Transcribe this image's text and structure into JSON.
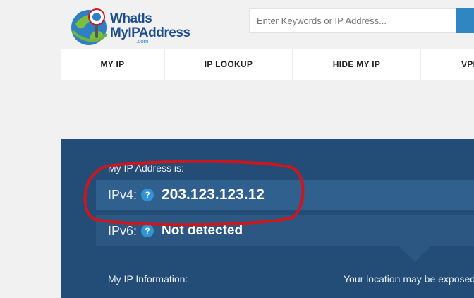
{
  "logo": {
    "line1": "WhatIs",
    "line2": "MyIPAddress",
    "suffix": ".com"
  },
  "search": {
    "placeholder": "Enter Keywords or IP Address..."
  },
  "nav": {
    "items": [
      "MY IP",
      "IP LOOKUP",
      "HIDE MY IP",
      "VPN"
    ]
  },
  "ip_panel": {
    "heading": "My IP Address is:",
    "ipv4": {
      "label": "IPv4:",
      "help": "?",
      "value": "203.123.123.12"
    },
    "ipv6": {
      "label": "IPv6:",
      "help": "?",
      "value": "Not detected"
    },
    "info_label": "My IP Information:",
    "location_label": "Your location may be exposed"
  },
  "colors": {
    "panel_bg": "#234c76",
    "accent": "#2f86c0",
    "annotation": "#d0161d"
  }
}
